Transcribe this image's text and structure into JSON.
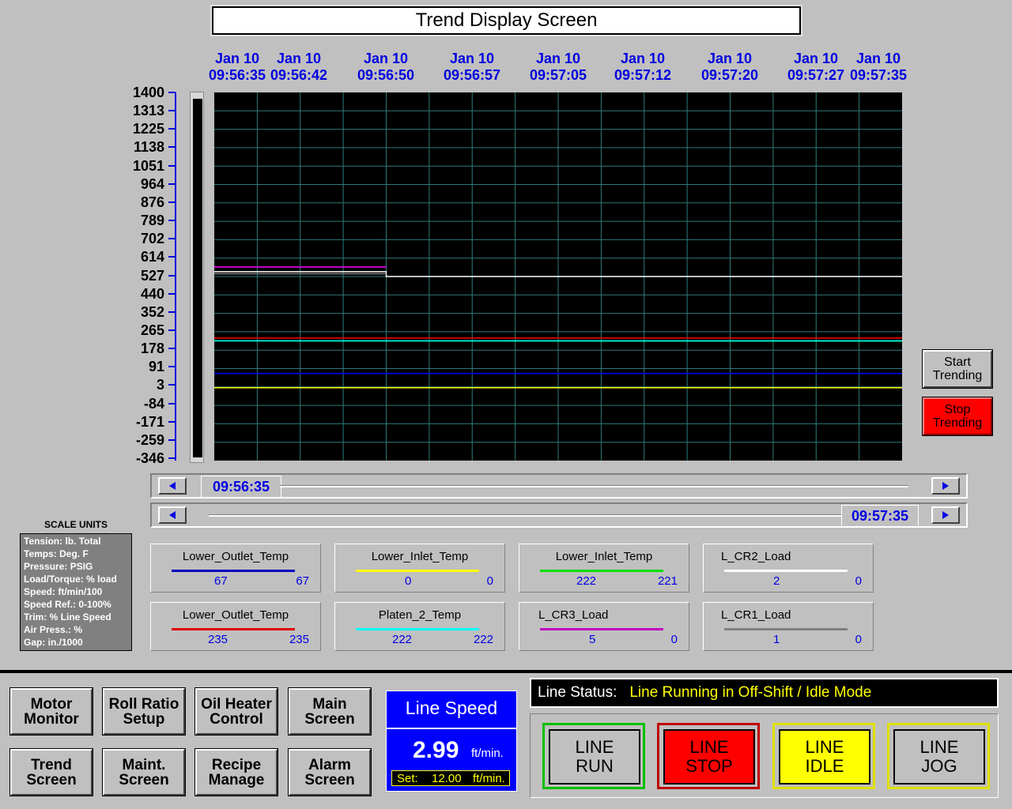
{
  "title": "Trend Display Screen",
  "time_labels": [
    {
      "date": "Jan 10",
      "time": "09:56:35"
    },
    {
      "date": "Jan 10",
      "time": "09:56:42"
    },
    {
      "date": "Jan 10",
      "time": "09:56:50"
    },
    {
      "date": "Jan 10",
      "time": "09:56:57"
    },
    {
      "date": "Jan 10",
      "time": "09:57:05"
    },
    {
      "date": "Jan 10",
      "time": "09:57:12"
    },
    {
      "date": "Jan 10",
      "time": "09:57:20"
    },
    {
      "date": "Jan 10",
      "time": "09:57:27"
    },
    {
      "date": "Jan 10",
      "time": "09:57:35"
    }
  ],
  "y_labels": [
    "1400",
    "1313",
    "1225",
    "1138",
    "1051",
    "964",
    "876",
    "789",
    "702",
    "614",
    "527",
    "440",
    "352",
    "265",
    "178",
    "91",
    "3",
    "-84",
    "-171",
    "-259",
    "-346"
  ],
  "chart_data": {
    "type": "line",
    "ylim": [
      -346,
      1400
    ],
    "x_range": [
      "09:56:35",
      "09:57:35"
    ],
    "grid": true,
    "series": [
      {
        "name": "Lower_Outlet_Temp",
        "color": "#0000ff",
        "points": [
          [
            "09:56:35",
            67
          ],
          [
            "09:57:35",
            67
          ]
        ]
      },
      {
        "name": "Lower_Inlet_Temp",
        "color": "#ffff00",
        "points": [
          [
            "09:56:35",
            0
          ],
          [
            "09:57:35",
            0
          ]
        ]
      },
      {
        "name": "Lower_Inlet_Temp",
        "color": "#00ff00",
        "points": [
          [
            "09:56:35",
            222
          ],
          [
            "09:57:35",
            221
          ]
        ]
      },
      {
        "name": "L_CR2_Load",
        "color": "#ffffff",
        "points": [
          [
            "09:56:35",
            550
          ],
          [
            "09:56:50",
            550
          ],
          [
            "09:56:50",
            527
          ],
          [
            "09:57:35",
            527
          ]
        ]
      },
      {
        "name": "Lower_Outlet_Temp",
        "color": "#ff0000",
        "points": [
          [
            "09:56:35",
            235
          ],
          [
            "09:57:35",
            235
          ]
        ]
      },
      {
        "name": "Platen_2_Temp",
        "color": "#00ffff",
        "points": [
          [
            "09:56:35",
            222
          ],
          [
            "09:57:35",
            222
          ]
        ]
      },
      {
        "name": "L_CR3_Load",
        "color": "#ff00ff",
        "points": [
          [
            "09:56:35",
            572
          ],
          [
            "09:56:50",
            572
          ]
        ]
      },
      {
        "name": "L_CR1_Load",
        "color": "#808080",
        "points": [
          [
            "09:56:35",
            540
          ],
          [
            "09:56:50",
            540
          ]
        ]
      }
    ]
  },
  "scroll": {
    "start_time": "09:56:35",
    "end_time": "09:57:35"
  },
  "trend_buttons": {
    "start": "Start Trending",
    "stop": "Stop Trending"
  },
  "scale_units": {
    "title": "SCALE UNITS",
    "lines": [
      "Tension: lb. Total",
      "Temps: Deg. F",
      "Pressure: PSIG",
      "Load/Torque: % load",
      "Speed: ft/min/100",
      "Speed Ref.: 0-100%",
      "Trim: % Line Speed",
      "Air Press.: %",
      "Gap: in./1000"
    ]
  },
  "pens": [
    {
      "name": "Lower_Outlet_Temp",
      "color": "#0000c0",
      "min": "67",
      "max": "67"
    },
    {
      "name": "Lower_Inlet_Temp",
      "color": "#ffff00",
      "min": "0",
      "max": "0"
    },
    {
      "name": "Lower_Inlet_Temp",
      "color": "#00e000",
      "min": "222",
      "max": "221"
    },
    {
      "name": "L_CR2_Load",
      "color": "#ffffff",
      "min": "2",
      "max": "0"
    },
    {
      "name": "Lower_Outlet_Temp",
      "color": "#e00000",
      "min": "235",
      "max": "235"
    },
    {
      "name": "Platen_2_Temp",
      "color": "#00ffff",
      "min": "222",
      "max": "222"
    },
    {
      "name": "L_CR3_Load",
      "color": "#c000c0",
      "min": "5",
      "max": "0"
    },
    {
      "name": "L_CR1_Load",
      "color": "#808080",
      "min": "1",
      "max": "0"
    }
  ],
  "nav": [
    {
      "key": "motor",
      "label1": "Motor",
      "label2": "Monitor"
    },
    {
      "key": "roll",
      "label1": "Roll Ratio",
      "label2": "Setup"
    },
    {
      "key": "oil",
      "label1": "Oil Heater",
      "label2": "Control"
    },
    {
      "key": "main",
      "label1": "Main",
      "label2": "Screen"
    },
    {
      "key": "trend",
      "label1": "Trend",
      "label2": "Screen"
    },
    {
      "key": "maint",
      "label1": "Maint.",
      "label2": "Screen"
    },
    {
      "key": "recipe",
      "label1": "Recipe",
      "label2": "Manage"
    },
    {
      "key": "alarm",
      "label1": "Alarm",
      "label2": "Screen"
    }
  ],
  "line_speed": {
    "title": "Line Speed",
    "value": "2.99",
    "unit": "ft/min.",
    "set_label": "Set:",
    "set_value": "12.00",
    "set_unit": "ft/min."
  },
  "line_status": {
    "label": "Line Status:",
    "value": "Line Running in Off-Shift / Idle Mode"
  },
  "line_controls": [
    {
      "key": "run",
      "line1": "LINE",
      "line2": "RUN",
      "bg": "#c0c0c0",
      "fg": "#000000",
      "frame": "#00c000"
    },
    {
      "key": "stop",
      "line1": "LINE",
      "line2": "STOP",
      "bg": "#ff0000",
      "fg": "#000000",
      "frame": "#c00000"
    },
    {
      "key": "idle",
      "line1": "LINE",
      "line2": "IDLE",
      "bg": "#ffff00",
      "fg": "#000000",
      "frame": "#e0e000"
    },
    {
      "key": "jog",
      "line1": "LINE",
      "line2": "JOG",
      "bg": "#c0c0c0",
      "fg": "#000000",
      "frame": "#e0e000"
    }
  ]
}
